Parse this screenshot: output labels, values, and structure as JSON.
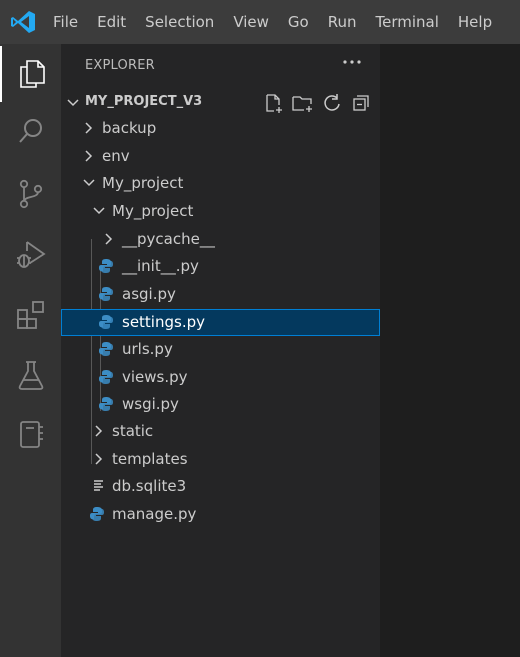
{
  "menu": [
    "File",
    "Edit",
    "Selection",
    "View",
    "Go",
    "Run",
    "Terminal",
    "Help"
  ],
  "activity_icons": [
    "explorer-icon",
    "search-icon",
    "source-control-icon",
    "run-debug-icon",
    "extensions-icon",
    "testing-icon",
    "notebook-icon"
  ],
  "explorer": {
    "title": "EXPLORER",
    "project_name": "MY_PROJECT_V3",
    "files": {
      "backup": "backup",
      "env": "env",
      "my_project_outer": "My_project",
      "my_project_inner": "My_project",
      "pycache": "__pycache__",
      "init": "__init__.py",
      "asgi": "asgi.py",
      "settings": "settings.py",
      "urls": "urls.py",
      "views": "views.py",
      "wsgi": "wsgi.py",
      "static": "static",
      "templates": "templates",
      "db": "db.sqlite3",
      "manage": "manage.py"
    },
    "selected": "settings.py"
  },
  "colors": {
    "accent": "#007fd4",
    "selection": "#04395e",
    "python_icon": "#3c8dc5",
    "vscode_blue": "#23a9f2"
  }
}
